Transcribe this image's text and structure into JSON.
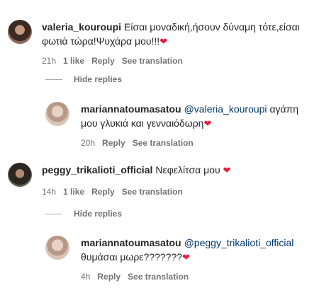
{
  "comments": [
    {
      "username": "valeria_kouroupi",
      "text": "Είσαι μοναδική,ήσουν δύναμη τότε,είσαι φωτιά τώρα!Ψυχάρα μου!!!",
      "heart": "❤",
      "time": "21h",
      "likes": "1 like",
      "reply": "Reply",
      "translation": "See translation",
      "hide_replies": "Hide replies",
      "replies": [
        {
          "username": "mariannatoumasatou",
          "mention": "@valeria_kouroupi",
          "text": "αγάπη μου γλυκιά και γενναιόδωρη",
          "heart": "❤",
          "time": "20h",
          "reply": "Reply",
          "translation": "See translation"
        }
      ]
    },
    {
      "username": "peggy_trikalioti_official",
      "text": "Νεφελίτσα μου",
      "heart": "❤",
      "time": "14h",
      "likes": "1 like",
      "reply": "Reply",
      "translation": "See translation",
      "hide_replies": "Hide replies",
      "replies": [
        {
          "username": "mariannatoumasatou",
          "mention": "@peggy_trikalioti_official",
          "text": "θυμάσαι μωρε???????",
          "heart": "❤",
          "time": "4h",
          "reply": "Reply",
          "translation": "See translation"
        }
      ]
    }
  ],
  "colors": {
    "text": "#262626",
    "secondary": "#737373",
    "mention": "#00376b",
    "heart": "#ed1c3a"
  }
}
